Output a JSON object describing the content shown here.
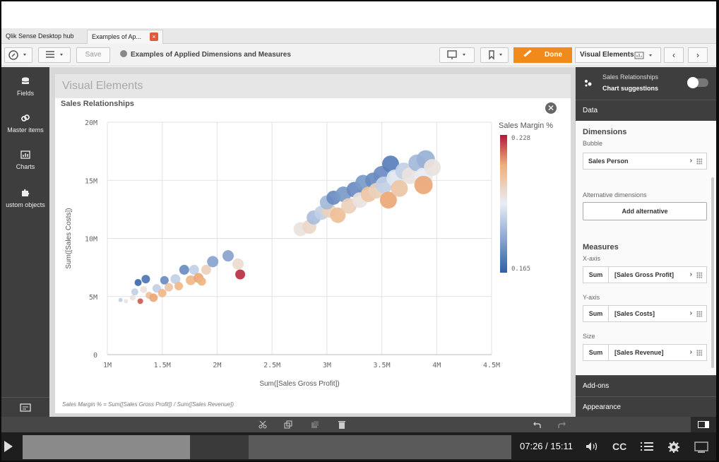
{
  "tabs": [
    {
      "label": "Qlik Sense Desktop hub"
    },
    {
      "label": "Examples of Ap...",
      "close": "×"
    }
  ],
  "toolbar": {
    "save_label": "Save",
    "app_title": "Examples of Applied Dimensions and Measures",
    "done_label": "Done",
    "visual_elements_label": "Visual Elements",
    "prev": "‹",
    "next": "›"
  },
  "leftbar": {
    "items": [
      {
        "label": "Fields",
        "icon": "database-icon"
      },
      {
        "label": "Master items",
        "icon": "link-icon"
      },
      {
        "label": "Charts",
        "icon": "bar-chart-icon"
      },
      {
        "label": "ustom objects",
        "icon": "puzzle-icon"
      }
    ]
  },
  "sheet": {
    "title": "Visual Elements",
    "chart_title": "Sales Relationships",
    "close": "✕",
    "footnote": "Sales Margin % = Sum([Sales Gross Profit]) / Sum([Sales Revenue])"
  },
  "chart_data": {
    "type": "scatter",
    "title": "Sales Relationships",
    "xlabel": "Sum([Sales Gross Profit])",
    "ylabel": "Sum([Sales Costs])",
    "xlim": [
      1000000,
      4500000
    ],
    "ylim": [
      0,
      20000000
    ],
    "x_ticks": [
      "1M",
      "1.5M",
      "2M",
      "2.5M",
      "3M",
      "3.5M",
      "4M",
      "4.5M"
    ],
    "y_ticks": [
      "0",
      "5M",
      "10M",
      "15M",
      "20M"
    ],
    "grid": true,
    "legend": {
      "title": "Sales Margin %",
      "min_label": "0.165",
      "max_label": "0.228",
      "min": 0.165,
      "max": 0.228,
      "placement": "right"
    },
    "colors": {
      "low": "#2f5fa8",
      "mid": "#e8eef6",
      "high": "#b1193a"
    },
    "points": [
      {
        "x": 1120000,
        "y": 4700000,
        "s": 3,
        "c": 0.19
      },
      {
        "x": 1170000,
        "y": 4600000,
        "s": 3,
        "c": 0.2
      },
      {
        "x": 1230000,
        "y": 4900000,
        "s": 4,
        "c": 0.2
      },
      {
        "x": 1250000,
        "y": 5400000,
        "s": 5,
        "c": 0.19
      },
      {
        "x": 1280000,
        "y": 6200000,
        "s": 5,
        "c": 0.167
      },
      {
        "x": 1300000,
        "y": 4600000,
        "s": 4,
        "c": 0.222
      },
      {
        "x": 1330000,
        "y": 5600000,
        "s": 5,
        "c": 0.2
      },
      {
        "x": 1350000,
        "y": 6500000,
        "s": 6,
        "c": 0.17
      },
      {
        "x": 1380000,
        "y": 5100000,
        "s": 5,
        "c": 0.21
      },
      {
        "x": 1420000,
        "y": 4900000,
        "s": 6,
        "c": 0.215
      },
      {
        "x": 1450000,
        "y": 5700000,
        "s": 6,
        "c": 0.19
      },
      {
        "x": 1500000,
        "y": 5300000,
        "s": 6,
        "c": 0.212
      },
      {
        "x": 1520000,
        "y": 6400000,
        "s": 6,
        "c": 0.175
      },
      {
        "x": 1560000,
        "y": 5800000,
        "s": 6,
        "c": 0.208
      },
      {
        "x": 1620000,
        "y": 6500000,
        "s": 7,
        "c": 0.19
      },
      {
        "x": 1650000,
        "y": 5900000,
        "s": 6,
        "c": 0.212
      },
      {
        "x": 1700000,
        "y": 7300000,
        "s": 7,
        "c": 0.175
      },
      {
        "x": 1760000,
        "y": 6400000,
        "s": 7,
        "c": 0.212
      },
      {
        "x": 1790000,
        "y": 7300000,
        "s": 7,
        "c": 0.19
      },
      {
        "x": 1830000,
        "y": 6600000,
        "s": 7,
        "c": 0.215
      },
      {
        "x": 1860000,
        "y": 6300000,
        "s": 6,
        "c": 0.213
      },
      {
        "x": 1900000,
        "y": 7300000,
        "s": 7,
        "c": 0.205
      },
      {
        "x": 1960000,
        "y": 8000000,
        "s": 8,
        "c": 0.18
      },
      {
        "x": 2100000,
        "y": 8500000,
        "s": 8,
        "c": 0.18
      },
      {
        "x": 2190000,
        "y": 7800000,
        "s": 8,
        "c": 0.202
      },
      {
        "x": 2210000,
        "y": 6900000,
        "s": 7,
        "c": 0.226
      },
      {
        "x": 2760000,
        "y": 10800000,
        "s": 10,
        "c": 0.2
      },
      {
        "x": 2840000,
        "y": 11000000,
        "s": 10,
        "c": 0.203
      },
      {
        "x": 2880000,
        "y": 11800000,
        "s": 10,
        "c": 0.186
      },
      {
        "x": 2950000,
        "y": 12200000,
        "s": 10,
        "c": 0.19
      },
      {
        "x": 3020000,
        "y": 12400000,
        "s": 10,
        "c": 0.205
      },
      {
        "x": 3000000,
        "y": 13100000,
        "s": 10,
        "c": 0.185
      },
      {
        "x": 3060000,
        "y": 13500000,
        "s": 10,
        "c": 0.175
      },
      {
        "x": 3100000,
        "y": 12000000,
        "s": 11,
        "c": 0.21
      },
      {
        "x": 3150000,
        "y": 13800000,
        "s": 11,
        "c": 0.178
      },
      {
        "x": 3200000,
        "y": 12800000,
        "s": 11,
        "c": 0.205
      },
      {
        "x": 3250000,
        "y": 14200000,
        "s": 11,
        "c": 0.175
      },
      {
        "x": 3300000,
        "y": 13300000,
        "s": 11,
        "c": 0.2
      },
      {
        "x": 3330000,
        "y": 14800000,
        "s": 11,
        "c": 0.178
      },
      {
        "x": 3380000,
        "y": 13800000,
        "s": 11,
        "c": 0.208
      },
      {
        "x": 3420000,
        "y": 15000000,
        "s": 11,
        "c": 0.175
      },
      {
        "x": 3450000,
        "y": 14100000,
        "s": 11,
        "c": 0.205
      },
      {
        "x": 3500000,
        "y": 15500000,
        "s": 12,
        "c": 0.175
      },
      {
        "x": 3520000,
        "y": 14600000,
        "s": 12,
        "c": 0.19
      },
      {
        "x": 3560000,
        "y": 13300000,
        "s": 12,
        "c": 0.215
      },
      {
        "x": 3580000,
        "y": 16400000,
        "s": 12,
        "c": 0.172
      },
      {
        "x": 3620000,
        "y": 15200000,
        "s": 12,
        "c": 0.195
      },
      {
        "x": 3660000,
        "y": 14300000,
        "s": 12,
        "c": 0.208
      },
      {
        "x": 3700000,
        "y": 15800000,
        "s": 12,
        "c": 0.19
      },
      {
        "x": 3760000,
        "y": 15400000,
        "s": 12,
        "c": 0.2
      },
      {
        "x": 3820000,
        "y": 16500000,
        "s": 12,
        "c": 0.185
      },
      {
        "x": 3880000,
        "y": 15300000,
        "s": 13,
        "c": 0.196
      },
      {
        "x": 3900000,
        "y": 16800000,
        "s": 13,
        "c": 0.183
      },
      {
        "x": 3960000,
        "y": 16100000,
        "s": 12,
        "c": 0.2
      },
      {
        "x": 3880000,
        "y": 14600000,
        "s": 13,
        "c": 0.215
      }
    ]
  },
  "rightpanel": {
    "header_line1": "Sales Relationships",
    "header_line2": "Chart suggestions",
    "data_tab": "Data",
    "dimensions_title": "Dimensions",
    "bubble_label": "Bubble",
    "dimension_field": "Sales Person",
    "alt_dimensions_label": "Alternative dimensions",
    "add_alternative": "Add alternative",
    "measures_title": "Measures",
    "measures": [
      {
        "axis": "X-axis",
        "agg": "Sum",
        "field": "[Sales Gross Profit]"
      },
      {
        "axis": "Y-axis",
        "agg": "Sum",
        "field": "[Sales Costs]"
      },
      {
        "axis": "Size",
        "agg": "Sum",
        "field": "[Sales Revenue]"
      }
    ],
    "addons": "Add-ons",
    "appearance": "Appearance"
  },
  "player": {
    "time": "07:26 / 15:11",
    "progress": 0.49
  }
}
